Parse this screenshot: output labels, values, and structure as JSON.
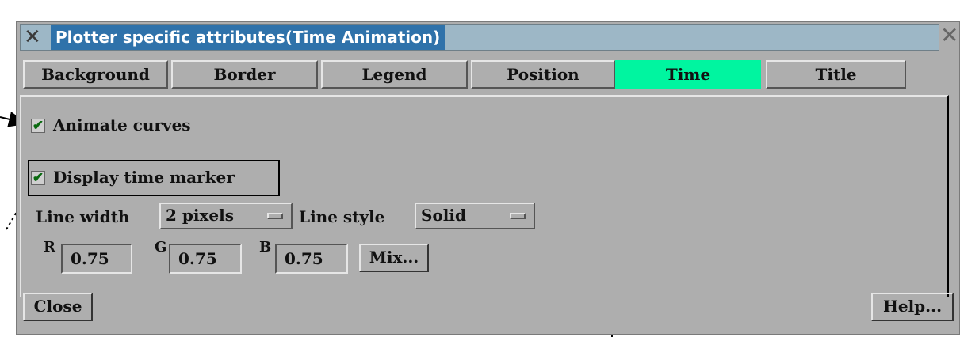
{
  "window": {
    "title": "Plotter specific attributes(Time Animation)"
  },
  "tabs": [
    {
      "label": "Background",
      "active": false
    },
    {
      "label": "Border",
      "active": false
    },
    {
      "label": "Legend",
      "active": false
    },
    {
      "label": "Position",
      "active": false
    },
    {
      "label": "Time",
      "active": true
    },
    {
      "label": "Title",
      "active": false
    }
  ],
  "time": {
    "animate_curves": {
      "label": "Animate curves",
      "checked": true
    },
    "display_time_marker": {
      "label": "Display time marker",
      "checked": true
    },
    "line_width": {
      "label": "Line width",
      "value": "2 pixels"
    },
    "line_style": {
      "label": "Line style",
      "value": "Solid"
    },
    "color": {
      "r_label": "R",
      "r": "0.75",
      "g_label": "G",
      "g": "0.75",
      "b_label": "B",
      "b": "0.75",
      "mix_label": "Mix..."
    }
  },
  "buttons": {
    "close": "Close",
    "help": "Help..."
  },
  "colors": {
    "title_bar": "#2f72aa",
    "active_tab": "#00f5a0",
    "window_bg": "#aeaeae"
  },
  "icons": {
    "window_menu": "x-logo-icon",
    "window_close": "close-icon",
    "checkmark": "checkmark-icon"
  }
}
